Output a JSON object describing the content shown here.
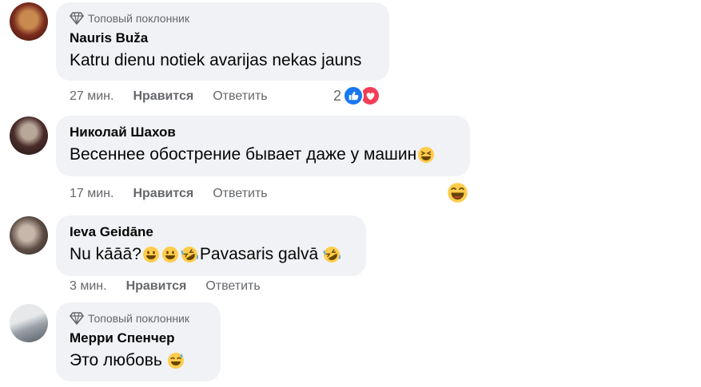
{
  "comments": [
    {
      "badge": "Топовый поклонник",
      "author": "Nauris Buža",
      "text": "Katru dienu notiek avarijas nekas jauns",
      "time": "27 мин.",
      "like_label": "Нравится",
      "reply_label": "Ответить",
      "reaction_count": "2",
      "reactions": [
        "like-icon",
        "love-icon"
      ]
    },
    {
      "author": "Николай Шахов",
      "text": "Весеннее обострение бывает даже у машин",
      "time": "17 мин.",
      "like_label": "Нравится",
      "reply_label": "Ответить",
      "reactions": [
        "haha-emoji-icon"
      ]
    },
    {
      "author": "Ieva Geidāne",
      "text_parts": [
        "Nu kāāā?",
        "Pavasaris galvā"
      ],
      "time": "3 мин.",
      "like_label": "Нравится",
      "reply_label": "Ответить"
    },
    {
      "badge": "Топовый поклонник",
      "author": "Мерри Спенчер",
      "text": "Это любовь",
      "emoji": "sweat-smile-emoji-icon"
    }
  ],
  "colors": {
    "bubble": "#f0f2f5",
    "secondary_text": "#65676b",
    "like_blue": "#1877f2",
    "love_red": "#f33e58",
    "emoji_yellow": "#ffcc4d"
  }
}
